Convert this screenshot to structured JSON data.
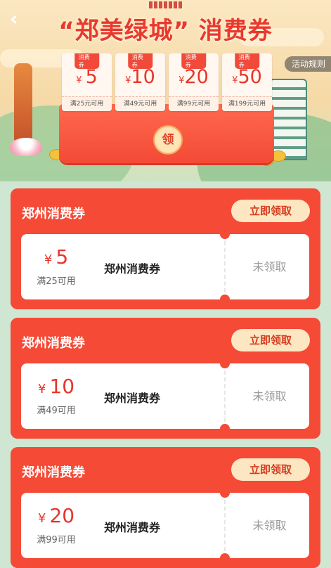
{
  "header": {
    "title": "“郑美绿城” 消费券",
    "back_icon": "chevron-left-icon",
    "rules_label": "活动规则"
  },
  "banner": {
    "claim_label": "领",
    "mini_coupons": [
      {
        "tag": "消费券",
        "currency": "¥",
        "amount": "5",
        "condition": "满25元可用"
      },
      {
        "tag": "消费券",
        "currency": "¥",
        "amount": "10",
        "condition": "满49元可用"
      },
      {
        "tag": "消费券",
        "currency": "¥",
        "amount": "20",
        "condition": "满99元可用"
      },
      {
        "tag": "消费券",
        "currency": "¥",
        "amount": "50",
        "condition": "满199元可用"
      }
    ]
  },
  "coupons": [
    {
      "section_title": "郑州消费券",
      "button_label": "立即领取",
      "currency": "¥",
      "amount": "5",
      "condition": "满25可用",
      "name": "郑州消费券",
      "status": "未领取"
    },
    {
      "section_title": "郑州消费券",
      "button_label": "立即领取",
      "currency": "¥",
      "amount": "10",
      "condition": "满49可用",
      "name": "郑州消费券",
      "status": "未领取"
    },
    {
      "section_title": "郑州消费券",
      "button_label": "立即领取",
      "currency": "¥",
      "amount": "20",
      "condition": "满99可用",
      "name": "郑州消费券",
      "status": "未领取"
    }
  ],
  "colors": {
    "accent_red": "#f44a36",
    "button_cream": "#fde7c2",
    "page_green": "#cfe6d3"
  }
}
